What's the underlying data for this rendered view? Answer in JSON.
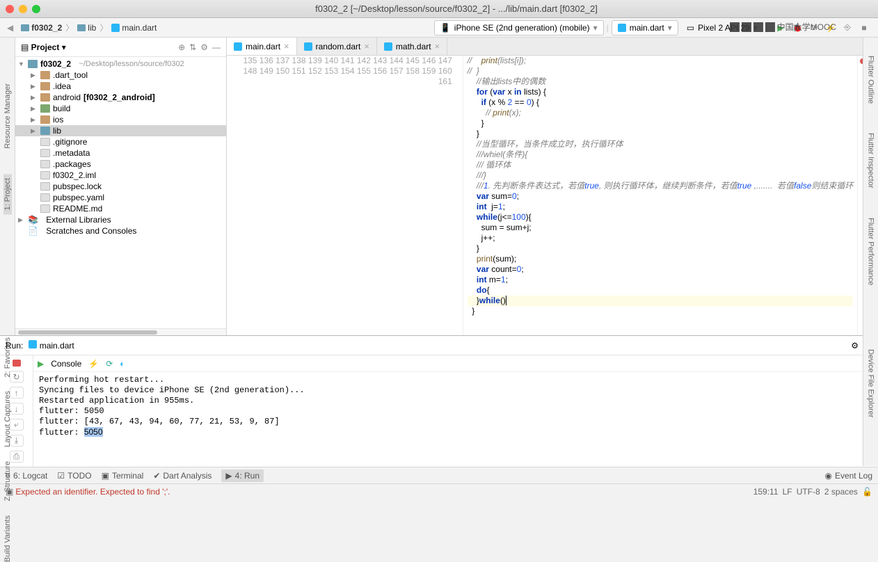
{
  "title": "f0302_2 [~/Desktop/lesson/source/f0302_2] - .../lib/main.dart [f0302_2]",
  "breadcrumb": [
    "f0302_2",
    "lib",
    "main.dart"
  ],
  "devices": {
    "primary": "iPhone SE (2nd generation) (mobile)",
    "config": "main.dart",
    "target": "Pixel 2 API 29"
  },
  "project": {
    "header": "Project",
    "root": {
      "name": "f0302_2",
      "path": "~/Desktop/lesson/source/f0302"
    },
    "items": [
      {
        "name": ".dart_tool",
        "type": "folder",
        "collapsed": true
      },
      {
        "name": ".idea",
        "type": "folder",
        "collapsed": true
      },
      {
        "name": "android",
        "suffix": "[f0302_2_android]",
        "type": "folder",
        "collapsed": true
      },
      {
        "name": "build",
        "type": "folder-green",
        "collapsed": true
      },
      {
        "name": "ios",
        "type": "folder",
        "collapsed": true
      },
      {
        "name": "lib",
        "type": "folder-blue",
        "collapsed": true,
        "sel": true
      },
      {
        "name": ".gitignore",
        "type": "file"
      },
      {
        "name": ".metadata",
        "type": "file"
      },
      {
        "name": ".packages",
        "type": "file"
      },
      {
        "name": "f0302_2.iml",
        "type": "file"
      },
      {
        "name": "pubspec.lock",
        "type": "file"
      },
      {
        "name": "pubspec.yaml",
        "type": "file"
      },
      {
        "name": "README.md",
        "type": "file"
      }
    ],
    "extra": [
      "External Libraries",
      "Scratches and Consoles"
    ]
  },
  "tabs": [
    {
      "label": "main.dart",
      "active": true
    },
    {
      "label": "random.dart",
      "active": false
    },
    {
      "label": "math.dart",
      "active": false
    }
  ],
  "gutter_start": 135,
  "gutter_end": 161,
  "code": [
    "//    print(lists[i]);",
    "//  }",
    "    //输出lists中的偶数",
    "    for (var x in lists) {",
    "      if (x % 2 == 0) {",
    "        // print(x);",
    "      }",
    "    }",
    "    //当型循环，当条件成立时，执行循环体",
    "    ///whiel(条件){",
    "    /// 循环体",
    "    ///}",
    "    ///1. 先判断条件表达式，若值true, 则执行循环体，继续判断条件，若值true ,.......  若值false则结束循环",
    "    var sum=0;",
    "    int  j=1;",
    "    while(j<=100){",
    "      sum = sum+j;",
    "      j++;",
    "    }",
    "    print(sum);",
    "    var count=0;",
    "    int m=1;",
    "    do{",
    "",
    "    }while()",
    "  }",
    ""
  ],
  "run": {
    "label": "Run:",
    "config": "main.dart",
    "console_tab": "Console",
    "output": [
      "Performing hot restart...",
      "Syncing files to device iPhone SE (2nd generation)...",
      "Restarted application in 955ms.",
      "flutter: 5050",
      "flutter: [43, 67, 43, 94, 60, 77, 21, 53, 9, 87]",
      "flutter: 5050"
    ]
  },
  "bottom": {
    "items": [
      "6: Logcat",
      "TODO",
      "Terminal",
      "Dart Analysis",
      "4: Run"
    ],
    "event_log": "Event Log"
  },
  "status": {
    "error": "Expected an identifier. Expected to find ';'.",
    "pos": "159:11",
    "lf": "LF",
    "enc": "UTF-8",
    "indent": "2 spaces"
  },
  "left_rail": [
    "Resource Manager",
    "1: Project"
  ],
  "right_rail": [
    "Flutter Outline",
    "Flutter Inspector",
    "Flutter Performance"
  ],
  "right_rail2": [
    "Device File Explorer"
  ],
  "left_bottom": [
    "2: Favorites",
    "Layout Captures",
    "Z. Structure",
    "Build Variants"
  ],
  "mooc": "中国大学MOOC"
}
